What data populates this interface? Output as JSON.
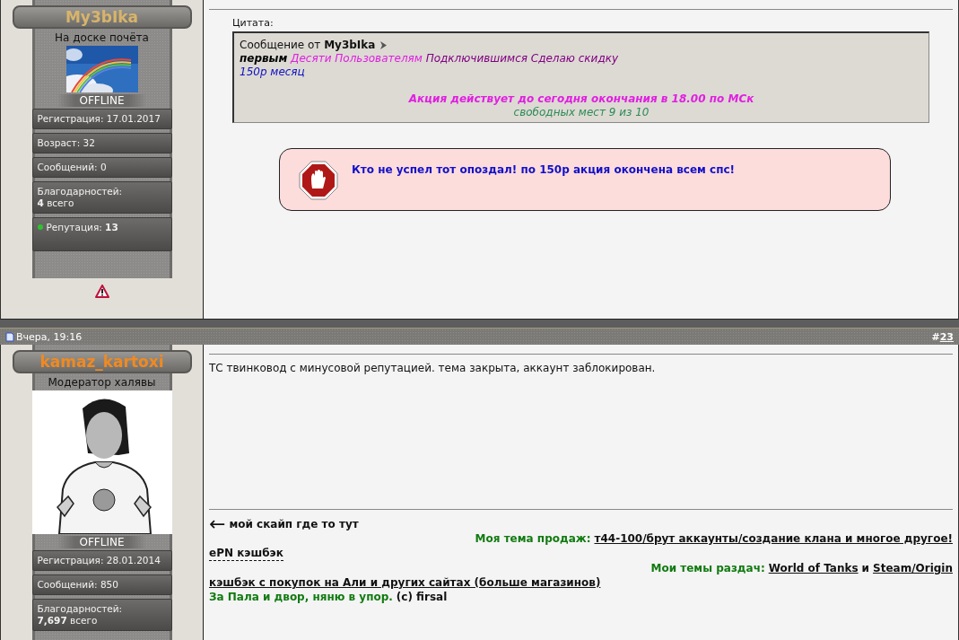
{
  "posts": [
    {
      "user": {
        "name": "My3bIka",
        "color": "#d8b46a",
        "title": "На доске почёта",
        "status": "OFFLINE",
        "stats": [
          {
            "kind": "plain",
            "lines": [
              "Регистрация: 17.01.2017"
            ]
          },
          {
            "kind": "plain",
            "lines": [
              "Возраст: 32"
            ]
          },
          {
            "kind": "plain",
            "lines": [
              "Сообщений: 0"
            ]
          },
          {
            "kind": "plain",
            "lines": [
              "Благодарностей:",
              "**4** всего"
            ]
          },
          {
            "kind": "reputation",
            "lines": [
              "Репутация: **13**"
            ]
          }
        ],
        "report": true
      },
      "body": {
        "quote": {
          "label": "Цитата:",
          "author": "Сообщение от **My3bIka**",
          "lines": [
            {
              "segments": [
                {
                  "kind": "bold",
                  "text": "первым"
                },
                {
                  "kind": "magenta",
                  "text": "Десяти Пользователям"
                },
                {
                  "kind": "purple",
                  "text": "Подключившимся Сделаю скидку"
                }
              ]
            },
            {
              "segments": [
                {
                  "kind": "blue",
                  "text": "150р месяц"
                }
              ]
            }
          ],
          "centered_lines": [
            {
              "segments": [
                {
                  "kind": "magenta-bold",
                  "text": "Акция действует до сегодня окончания в 18.00 по МСк"
                }
              ]
            },
            {
              "segments": [
                {
                  "kind": "green",
                  "text": "свободных мест 9 из 10"
                }
              ]
            }
          ]
        },
        "notice": "Кто не успел тот опоздал! по 150р акция окончена всем спс!"
      }
    },
    {
      "header": {
        "date": "Вчера, 19:16",
        "number_prefix": "#",
        "number": "23"
      },
      "user": {
        "name": "kamaz_kartoxi",
        "color": "#f08a22",
        "title": "Модератор халявы",
        "avatar": {
          "kind": "figure"
        },
        "status": "OFFLINE",
        "stats": [
          {
            "kind": "plain",
            "lines": [
              "Регистрация: 28.01.2014"
            ]
          },
          {
            "kind": "plain",
            "lines": [
              "Сообщений: 850"
            ]
          },
          {
            "kind": "plain",
            "lines": [
              "Благодарностей:",
              "**7,697** всего"
            ]
          }
        ],
        "report": false
      },
      "body": {
        "text": "ТС твинковод с минусовой репутацией. тема закрыта, аккаунт заблокирован.",
        "signature": [
          {
            "right_aligned": false,
            "segments": [
              {
                "kind": "arrow",
                "text": "←"
              },
              {
                "kind": "plain",
                "text": "мой скайп где то тут"
              }
            ]
          },
          {
            "right_aligned": true,
            "segments": [
              {
                "kind": "green",
                "text": "Моя тема продаж:"
              },
              {
                "kind": "link",
                "text": "т44-100/брут аккаунты/создание клана и многое другое!"
              }
            ]
          },
          {
            "right_aligned": false,
            "segments": [
              {
                "kind": "dashed-link",
                "text": "ePN кэшбэк"
              }
            ]
          },
          {
            "right_aligned": true,
            "segments": [
              {
                "kind": "green",
                "text": "Мои темы раздач:"
              },
              {
                "kind": "link",
                "text": "World of Tanks"
              },
              {
                "kind": "plain",
                "text": "и"
              },
              {
                "kind": "link",
                "text": "Steam/Origin"
              }
            ]
          },
          {
            "right_aligned": false,
            "segments": [
              {
                "kind": "link",
                "text": "кэшбэк с покупок на Али и других сайтах (больше магазинов)"
              }
            ]
          },
          {
            "right_aligned": false,
            "segments": [
              {
                "kind": "green",
                "text": "За Пала и двор, няню в упор."
              },
              {
                "kind": "plain",
                "text": "(с) firsal"
              }
            ]
          }
        ]
      }
    }
  ]
}
